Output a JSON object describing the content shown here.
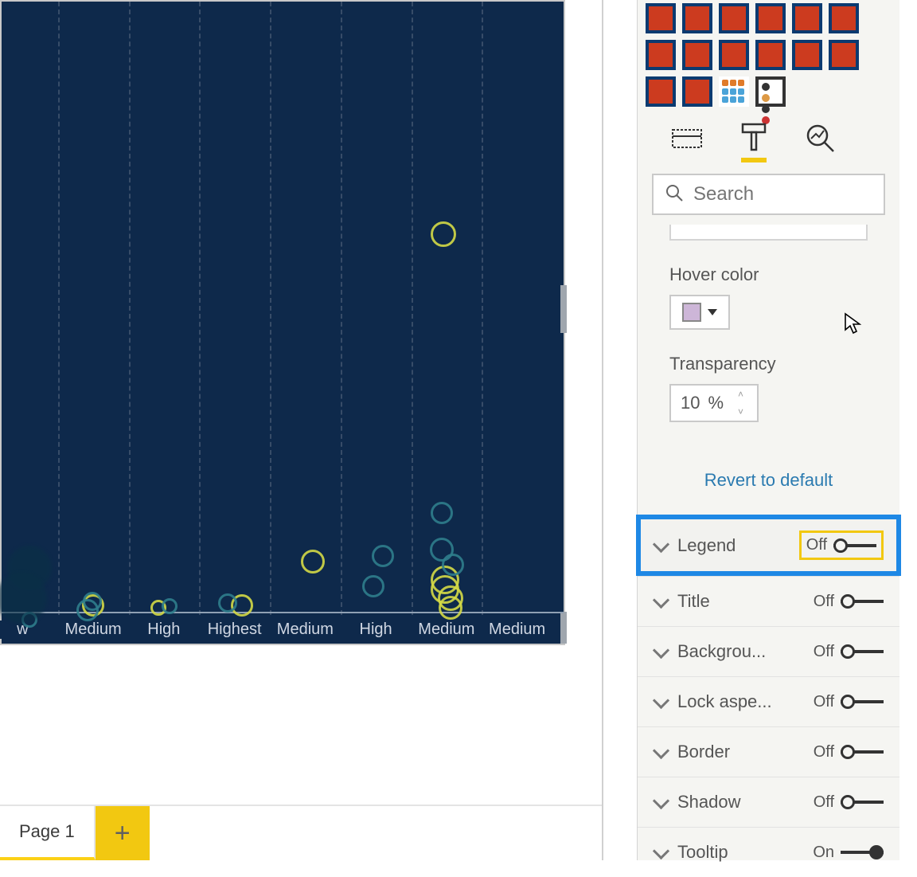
{
  "chart_data": {
    "type": "scatter",
    "categories": [
      "w",
      "Medium",
      "High",
      "Highest",
      "Medium",
      "High",
      "Medium",
      "Medium"
    ],
    "series": [
      {
        "name": "yellow",
        "color": "#d4d946",
        "points": [
          {
            "col": 6,
            "y": 0.63,
            "r": 16
          },
          {
            "col": 4,
            "y": 0.09,
            "r": 15
          },
          {
            "col": 6,
            "y": 0.06,
            "r": 18
          },
          {
            "col": 6,
            "y": 0.045,
            "r": 18
          },
          {
            "col": 6,
            "y": 0.03,
            "r": 16
          },
          {
            "col": 6,
            "y": 0.015,
            "r": 15
          },
          {
            "col": 1,
            "y": 0.018,
            "r": 14
          },
          {
            "col": 3,
            "y": 0.018,
            "r": 14
          },
          {
            "col": 2,
            "y": 0.015,
            "r": 10
          }
        ]
      },
      {
        "name": "teal",
        "color": "#2f7d8c",
        "points": [
          {
            "col": 6,
            "y": 0.17,
            "r": 14
          },
          {
            "col": 5,
            "y": 0.1,
            "r": 14
          },
          {
            "col": 5,
            "y": 0.05,
            "r": 14
          },
          {
            "col": 6,
            "y": 0.11,
            "r": 15
          },
          {
            "col": 6,
            "y": 0.085,
            "r": 14
          },
          {
            "col": 1,
            "y": 0.025,
            "r": 12
          },
          {
            "col": 1,
            "y": 0.01,
            "r": 14
          },
          {
            "col": 2,
            "y": 0.017,
            "r": 10
          },
          {
            "col": 3,
            "y": 0.022,
            "r": 12
          },
          {
            "col": 0,
            "y": -0.005,
            "r": 10
          }
        ]
      },
      {
        "name": "dark-blob",
        "color": "#0a3046",
        "points": [
          {
            "col": 0,
            "y": 0.08,
            "r": 28
          },
          {
            "col": 0,
            "y": 0.03,
            "r": 32
          }
        ]
      }
    ],
    "xlabel": "",
    "ylabel": "",
    "title": ""
  },
  "page_tab": {
    "name": "Page 1"
  },
  "search": {
    "placeholder": "Search"
  },
  "hover": {
    "label": "Hover color",
    "color": "#cdb6d8"
  },
  "transparency": {
    "label": "Transparency",
    "value": "10",
    "unit": "%"
  },
  "revert": "Revert to default",
  "format_rows": [
    {
      "label": "Legend",
      "state": "Off",
      "highlighted": true,
      "on": false
    },
    {
      "label": "Title",
      "state": "Off",
      "on": false
    },
    {
      "label": "Backgrou...",
      "state": "Off",
      "on": false
    },
    {
      "label": "Lock aspe...",
      "state": "Off",
      "on": false
    },
    {
      "label": "Border",
      "state": "Off",
      "on": false
    },
    {
      "label": "Shadow",
      "state": "Off",
      "on": false
    },
    {
      "label": "Tooltip",
      "state": "On",
      "on": true
    }
  ]
}
